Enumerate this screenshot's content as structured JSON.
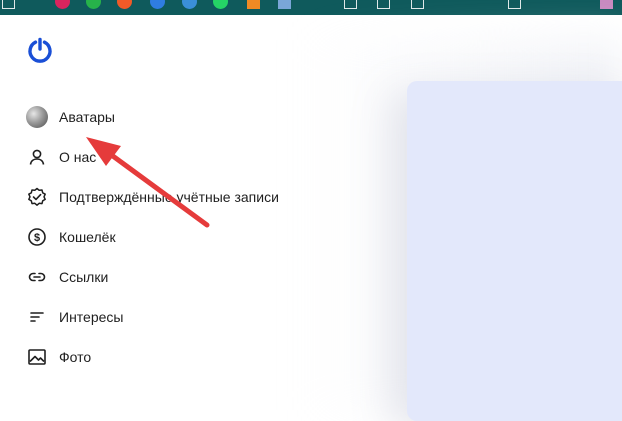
{
  "nav": {
    "items": [
      {
        "label": "Аватары",
        "icon": "avatar"
      },
      {
        "label": "О нас",
        "icon": "user-icon"
      },
      {
        "label": "Подтверждённые учётные записи",
        "icon": "verified-badge-icon"
      },
      {
        "label": "Кошелёк",
        "icon": "dollar-coin-icon"
      },
      {
        "label": "Ссылки",
        "icon": "link-icon"
      },
      {
        "label": "Интересы",
        "icon": "interests-lines-icon"
      },
      {
        "label": "Фото",
        "icon": "image-icon"
      }
    ]
  },
  "colors": {
    "logo": "#1a4fd6",
    "panel": "#e3e8fb",
    "arrow": "#e53b3b",
    "taskbar": "#0f5a5c"
  }
}
